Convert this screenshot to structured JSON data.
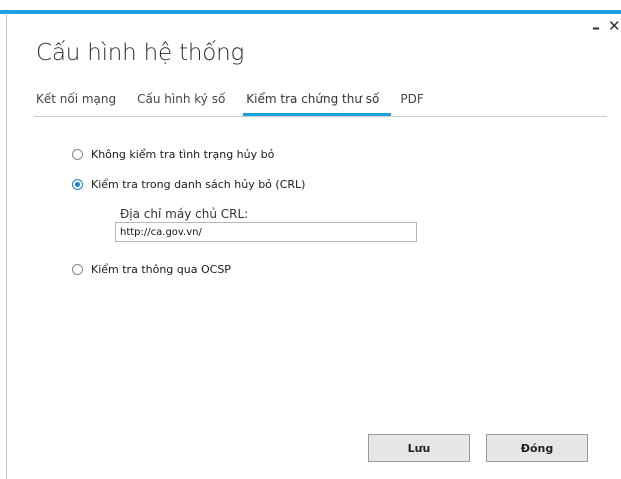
{
  "window": {
    "title": "Cấu hình hệ thống",
    "minimize_glyph": "–",
    "close_glyph": "✕",
    "accent_color": "#1ba1e2"
  },
  "tabs": [
    {
      "label": "Kết nối mạng",
      "active": false
    },
    {
      "label": "Cấu hình ký số",
      "active": false
    },
    {
      "label": "Kiểm tra chứng thư số",
      "active": true
    },
    {
      "label": "PDF",
      "active": false
    }
  ],
  "options": {
    "no_check": {
      "label": "Không kiểm tra tình trạng hủy bỏ",
      "checked": false
    },
    "crl": {
      "label": "Kiểm tra trong danh sách hủy bỏ (CRL)",
      "checked": true
    },
    "ocsp": {
      "label": "Kiểm tra thông qua OCSP",
      "checked": false
    }
  },
  "crl_server": {
    "label": "Địa chỉ máy chủ CRL:",
    "value": "http://ca.gov.vn/"
  },
  "buttons": {
    "save": "Lưu",
    "close": "Đóng"
  }
}
